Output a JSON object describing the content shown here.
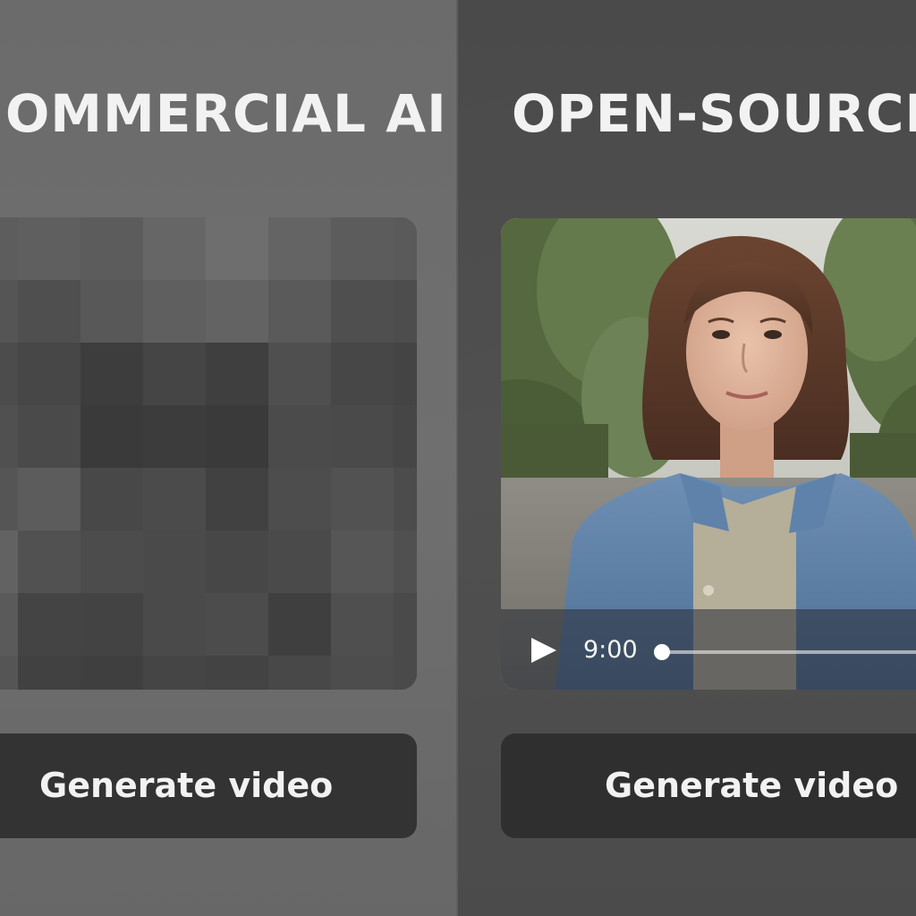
{
  "left_panel": {
    "title": "OMMERCIAL AI",
    "preview": "pixelated",
    "generate_label": "Generate video"
  },
  "right_panel": {
    "title": "OPEN-SOURCE A",
    "player": {
      "time": "9:00",
      "progress": 0
    },
    "generate_label": "Generate video"
  },
  "colors": {
    "panel_left_bg": "#6b6b6b",
    "panel_right_bg": "#4a4a4a",
    "button_bg": "#333333",
    "text": "#f2f2f2"
  },
  "icons": {
    "play": "play-icon"
  }
}
